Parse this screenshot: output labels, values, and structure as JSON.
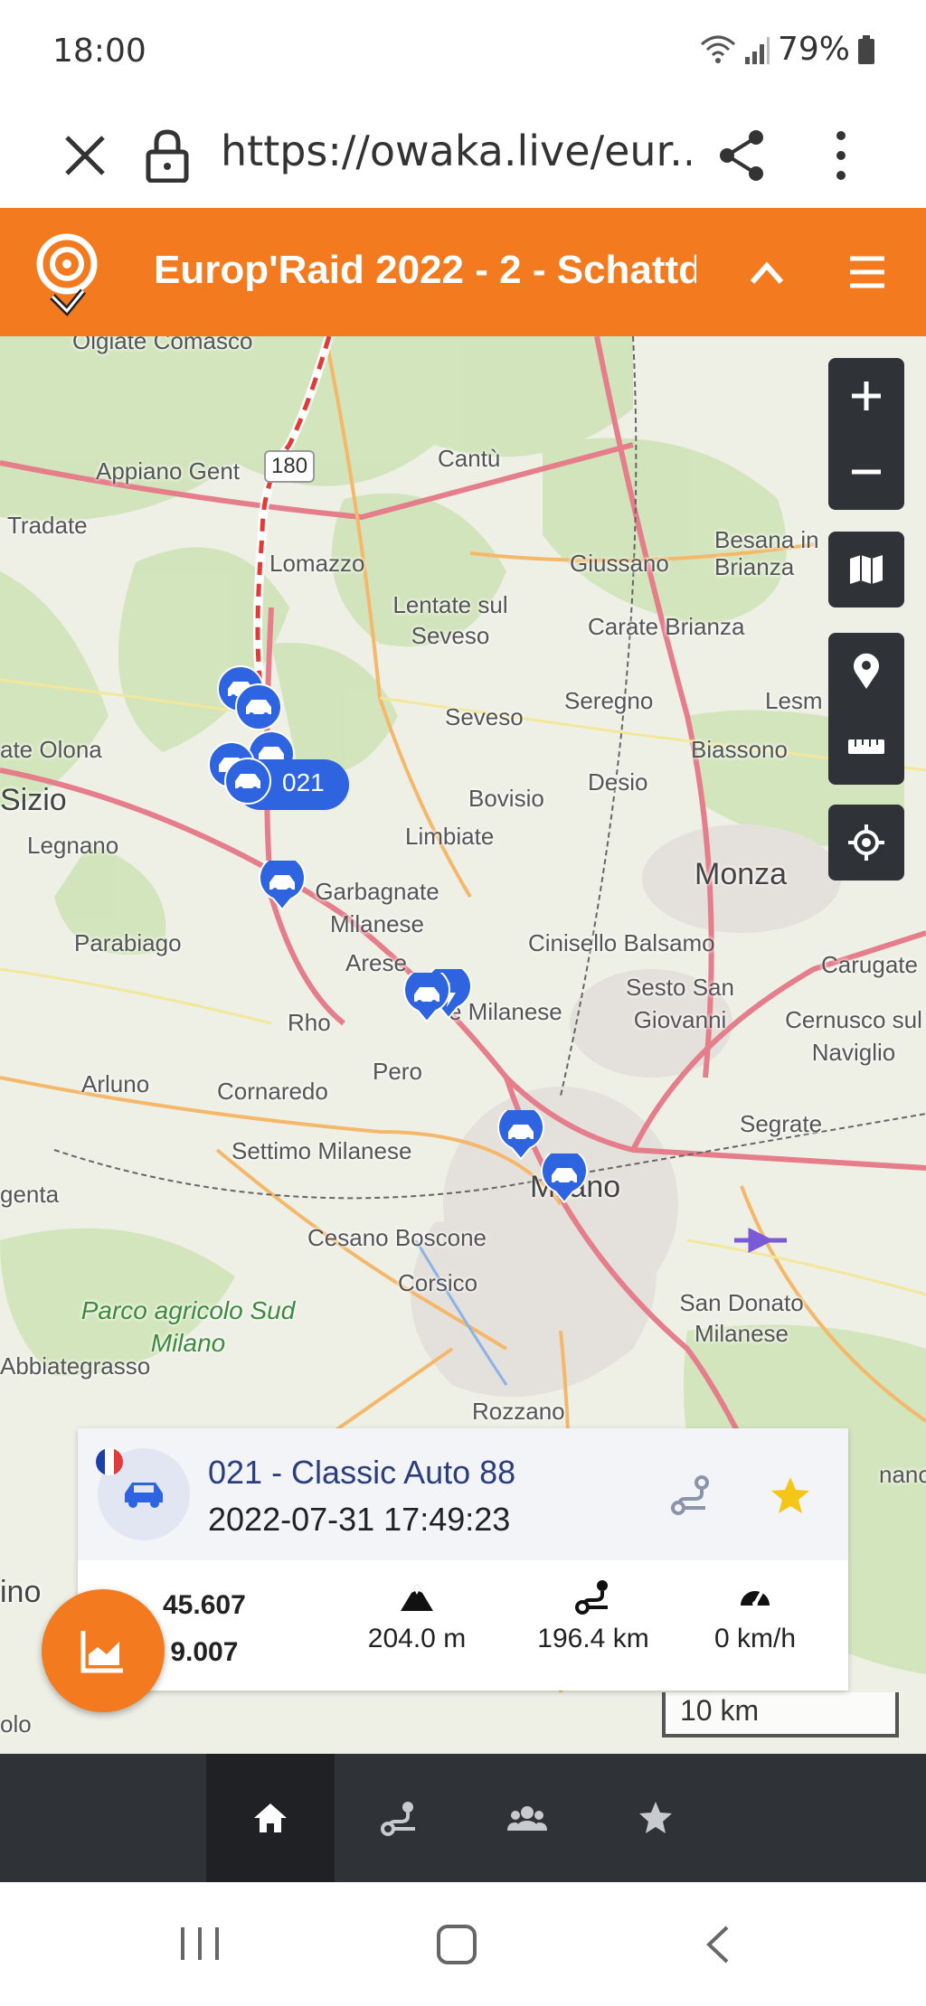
{
  "status_bar": {
    "time": "18:00",
    "battery": "79%"
  },
  "browser": {
    "url": "https://owaka.live/eur..."
  },
  "header": {
    "title": "Europ'Raid 2022 - 2 - Schattd..."
  },
  "map": {
    "road_number": "180",
    "places": {
      "olgiate": "Olgiate Comasco",
      "appiano": "Appiano Gent",
      "tradate": "Tradate",
      "cantu": "Cantù",
      "lomazzo": "Lomazzo",
      "giussano": "Giussano",
      "besana": "Besana in Brianza",
      "lentate": "Lentate sul Seveso",
      "carate": "Carate Brianza",
      "seveso": "Seveso",
      "seregno": "Seregno",
      "lesmo": "Lesm",
      "olona": "ate Olona",
      "biassono": "Biassono",
      "desio": "Desio",
      "sizio": "Sizio",
      "bovisio": "Bovisio",
      "legnano": "Legnano",
      "limbiate": "Limbiate",
      "monza": "Monza",
      "garbagnate": "Garbagnate Milanese",
      "parabiago": "Parabiago",
      "cinisello": "Cinisello Balsamo",
      "arese": "Arese",
      "carugate": "Carugate",
      "sesto": "Sesto San Giovanni",
      "rho": "Rho",
      "bollate_milanese": "e Milanese",
      "cernusco": "Cernusco sul Naviglio",
      "pero": "Pero",
      "arluno": "Arluno",
      "cornaredo": "Cornaredo",
      "segrate": "Segrate",
      "settimo": "Settimo Milanese",
      "agenta": "genta",
      "milano": "Milano",
      "cesano": "Cesano Boscone",
      "corsico": "Corsico",
      "parco": "Parco agricolo Sud Milano",
      "sandonato": "San Donato Milanese",
      "abbiategrasso": "Abbiategrasso",
      "rozzano": "Rozzano",
      "nano": "nano",
      "ino": "ino",
      "olo": "olo"
    },
    "cluster_label": "021",
    "scale": "10 km"
  },
  "vehicle_card": {
    "name": "021 - Classic Auto 88",
    "timestamp": "2022-07-31 17:49:23",
    "latitude": "45.607",
    "longitude": "9.007",
    "altitude": "204.0 m",
    "distance": "196.4 km",
    "speed": "0 km/h"
  },
  "colors": {
    "brand": "#f47a1f",
    "marker": "#2e64e0",
    "dark": "#2f3237"
  }
}
